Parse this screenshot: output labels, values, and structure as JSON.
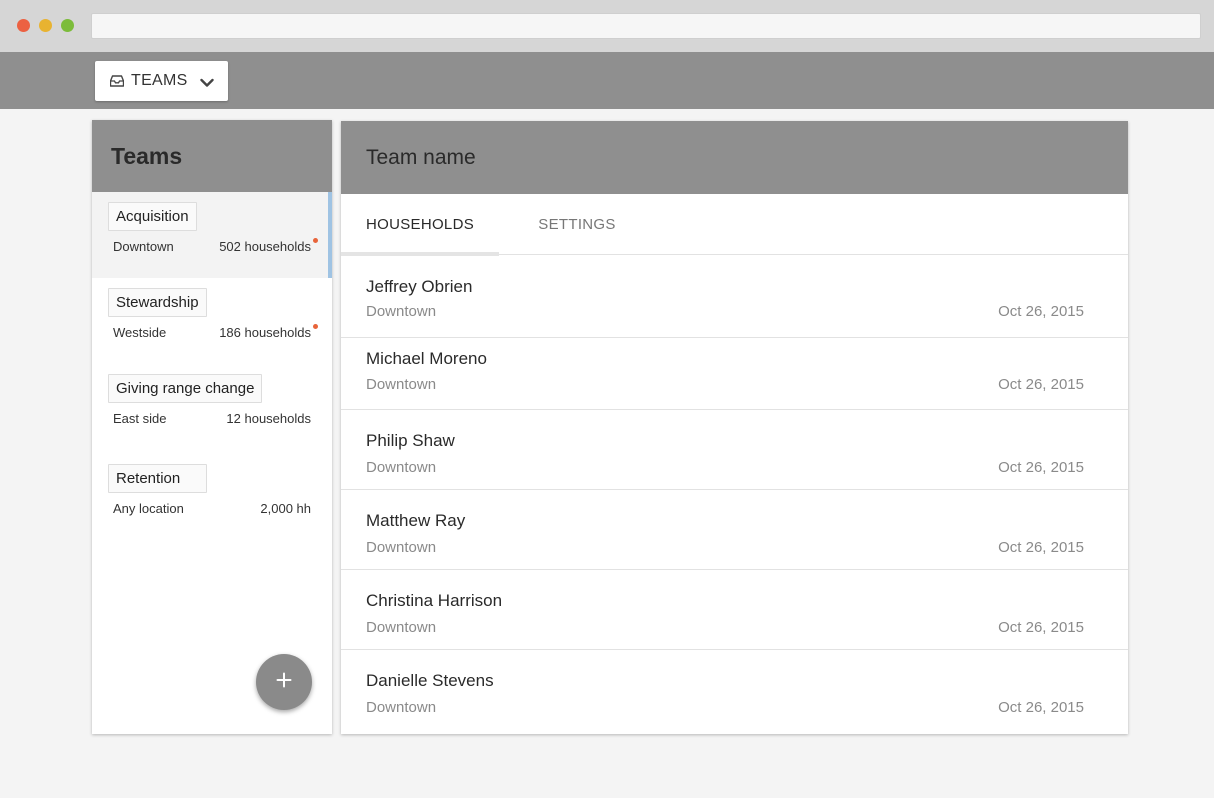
{
  "topbar": {
    "team_select": {
      "label": "TEAMS",
      "icon": "inbox-icon"
    }
  },
  "sidebar": {
    "title": "Teams",
    "items": [
      {
        "name": "Acquisition",
        "location": "Downtown",
        "count": "502 households",
        "has_badge": true,
        "active": true
      },
      {
        "name": "Stewardship",
        "location": "Westside",
        "count": "186 households",
        "has_badge": true,
        "active": false
      },
      {
        "name": "Giving range change",
        "location": "East side",
        "count": "12 households",
        "has_badge": false,
        "active": false
      },
      {
        "name": "Retention",
        "location": "Any location",
        "count": "2,000 hh",
        "has_badge": false,
        "active": false
      }
    ],
    "add_button_icon": "plus-icon"
  },
  "main": {
    "title": "Team name",
    "tabs": [
      {
        "label": "HOUSEHOLDS",
        "active": true
      },
      {
        "label": "SETTINGS",
        "active": false
      }
    ],
    "rows": [
      {
        "name": "Jeffrey Obrien",
        "location": "Downtown",
        "date": "Oct 26, 2015"
      },
      {
        "name": "Michael Moreno",
        "location": "Downtown",
        "date": "Oct 26, 2015"
      },
      {
        "name": "Philip Shaw",
        "location": "Downtown",
        "date": "Oct 26, 2015"
      },
      {
        "name": "Matthew Ray",
        "location": "Downtown",
        "date": "Oct 26, 2015"
      },
      {
        "name": "Christina Harrison",
        "location": "Downtown",
        "date": "Oct 26, 2015"
      },
      {
        "name": "Danielle Stevens",
        "location": "Downtown",
        "date": "Oct 26, 2015"
      }
    ]
  },
  "colors": {
    "header_gray": "#8f8f8f",
    "badge": "#e8643a",
    "active_indicator": "#9fc3e3"
  }
}
